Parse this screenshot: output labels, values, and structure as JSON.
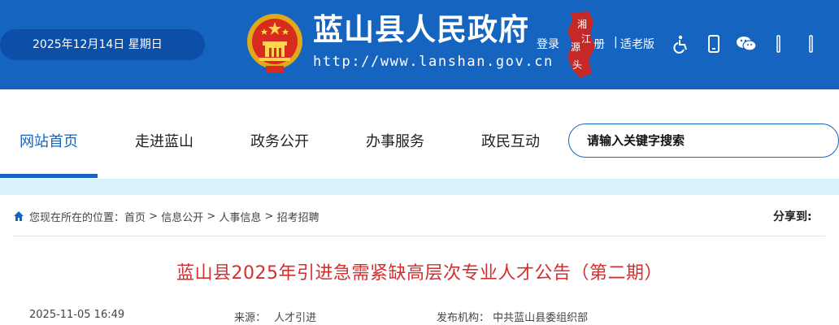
{
  "header": {
    "date": "2025年12月14日 星期日",
    "site_title": "蓝山县人民政府",
    "site_url": "http://www.lanshan.gov.cn",
    "seal_text": "湘江源头",
    "login": "登录",
    "register": "册",
    "separator": "|",
    "elderly_mode": "适老版",
    "icons": [
      "accessibility-icon",
      "mobile-icon",
      "wechat-icon",
      "weibo-icon",
      "more-icon"
    ],
    "brand_color": "#1565c0"
  },
  "nav": {
    "items": [
      {
        "label": "网站首页",
        "active": true
      },
      {
        "label": "走进蓝山"
      },
      {
        "label": "政务公开"
      },
      {
        "label": "办事服务"
      },
      {
        "label": "政民互动"
      }
    ],
    "search_placeholder": "请输入关键字搜索"
  },
  "breadcrumb": {
    "prefix": "您现在所在的位置：",
    "items": [
      "首页",
      "信息公开",
      "人事信息",
      "招考招聘"
    ],
    "sep": " > "
  },
  "share_label": "分享到:",
  "article": {
    "title": "蓝山县2025年引进急需紧缺高层次专业人才公告（第二期）",
    "title_color": "#d32f2f",
    "date": "2025-11-05 16:49",
    "source_label": "来源：",
    "source": "人才引进",
    "publisher_label": "发布机构：",
    "publisher": "中共蓝山县委组织部"
  }
}
